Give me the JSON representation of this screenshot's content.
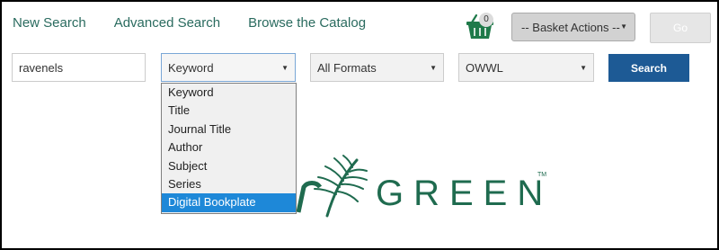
{
  "nav": {
    "new_search": "New Search",
    "advanced_search": "Advanced Search",
    "browse_catalog": "Browse the Catalog"
  },
  "basket": {
    "count": "0",
    "actions_label": "-- Basket Actions --",
    "go_label": "Go"
  },
  "search": {
    "query": "ravenels",
    "type_selected": "Keyword",
    "format_selected": "All Formats",
    "library_selected": "OWWL",
    "button_label": "Search",
    "type_options": [
      "Keyword",
      "Title",
      "Journal Title",
      "Author",
      "Subject",
      "Series",
      "Digital Bookplate"
    ],
    "highlighted_option": "Digital Bookplate"
  },
  "logo": {
    "text": "GREEN",
    "trademark": "TM"
  },
  "colors": {
    "nav_link": "#2a6b5f",
    "search_button": "#1d5a95",
    "highlight": "#1e88d8",
    "logo_green": "#1f6b4f"
  },
  "icons": {
    "basket": "basket-icon",
    "caret": "caret-down-icon",
    "logo": "evergreen-fern-logo"
  }
}
